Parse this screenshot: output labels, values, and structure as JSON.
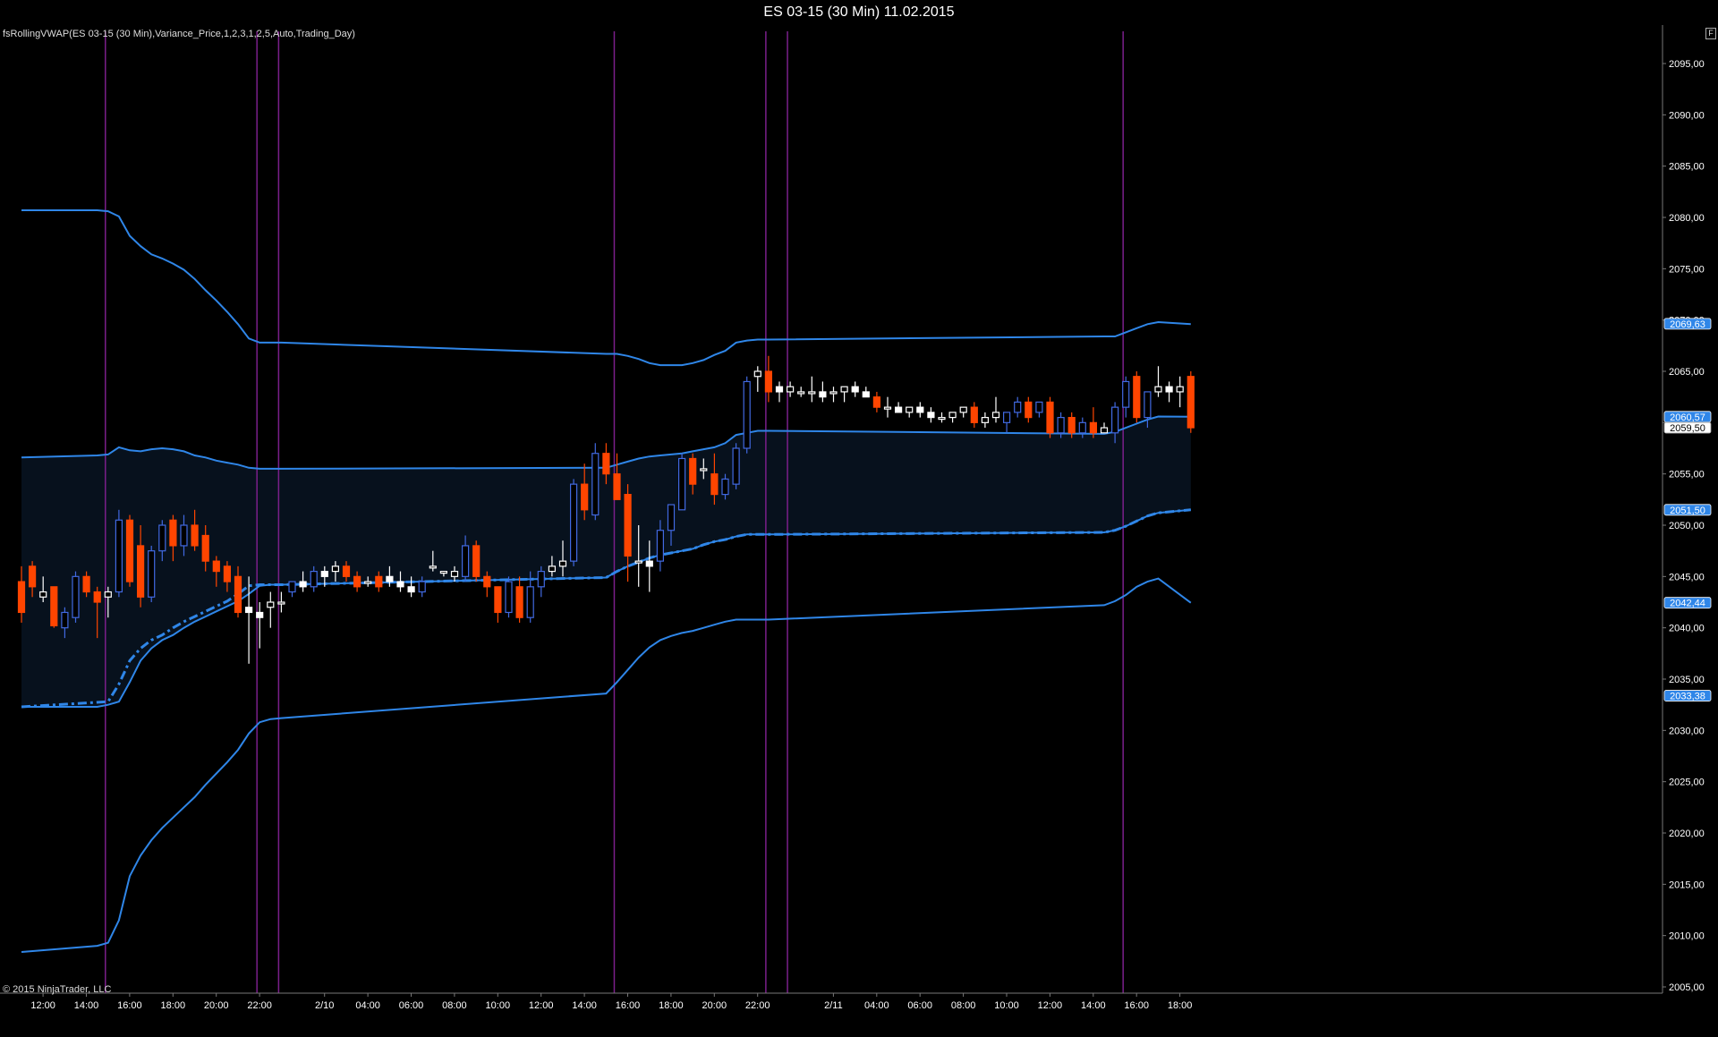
{
  "window": {
    "title": "ES 03-15 (30 Min)  11.02.2015",
    "indicator_label": "fsRollingVWAP(ES 03-15 (30 Min),Variance_Price,1,2,3,1,2,5,Auto,Trading_Day)",
    "copyright": "© 2015 NinjaTrader, LLC",
    "corner_button": "F"
  },
  "colors": {
    "background": "#000000",
    "band": "#2f86e8",
    "vwap": "#2f86e8",
    "band_fill": "#07111d",
    "candle_up": "#4169e1",
    "candle_down": "#ff4500",
    "doji": "#ffffff",
    "session_line": "#7a1f8a",
    "axis_text": "#ffffff",
    "price_marker": "#2f86e8"
  },
  "chart_data": {
    "type": "candlestick",
    "bar_interval_min": 30,
    "x_start": "2015-02-09 11:30",
    "ylim": [
      2004,
      2099
    ],
    "y_ticks": [
      "2005,00",
      "2010,00",
      "2015,00",
      "2020,00",
      "2025,00",
      "2030,00",
      "2035,00",
      "2040,00",
      "2045,00",
      "2050,00",
      "2055,00",
      "2060,00",
      "2065,00",
      "2070,00",
      "2075,00",
      "2080,00",
      "2085,00",
      "2090,00",
      "2095,00"
    ],
    "y_tick_values": [
      2005,
      2010,
      2015,
      2020,
      2025,
      2030,
      2035,
      2040,
      2045,
      2050,
      2055,
      2060,
      2065,
      2070,
      2075,
      2080,
      2085,
      2090,
      2095
    ],
    "x_ticks": [
      {
        "label": "12:00",
        "bar": 1
      },
      {
        "label": "14:00",
        "bar": 5
      },
      {
        "label": "16:00",
        "bar": 9
      },
      {
        "label": "18:00",
        "bar": 13
      },
      {
        "label": "20:00",
        "bar": 17
      },
      {
        "label": "22:00",
        "bar": 21
      },
      {
        "label": "2/10",
        "bar": 27
      },
      {
        "label": "04:00",
        "bar": 31
      },
      {
        "label": "06:00",
        "bar": 35
      },
      {
        "label": "08:00",
        "bar": 39
      },
      {
        "label": "10:00",
        "bar": 43
      },
      {
        "label": "12:00",
        "bar": 47
      },
      {
        "label": "14:00",
        "bar": 51
      },
      {
        "label": "16:00",
        "bar": 55
      },
      {
        "label": "18:00",
        "bar": 59
      },
      {
        "label": "20:00",
        "bar": 63
      },
      {
        "label": "22:00",
        "bar": 67
      },
      {
        "label": "2/11",
        "bar": 74
      },
      {
        "label": "04:00",
        "bar": 78
      },
      {
        "label": "06:00",
        "bar": 82
      },
      {
        "label": "08:00",
        "bar": 86
      },
      {
        "label": "10:00",
        "bar": 90
      },
      {
        "label": "12:00",
        "bar": 94
      },
      {
        "label": "14:00",
        "bar": 98
      },
      {
        "label": "16:00",
        "bar": 102
      },
      {
        "label": "18:00",
        "bar": 106
      }
    ],
    "session_lines": [
      7.75,
      21.75,
      23.75,
      54.75,
      68.75,
      70.75,
      101.75
    ],
    "price_markers": [
      {
        "label": "2069,63",
        "value": 2069.63,
        "style": "band"
      },
      {
        "label": "2060,57",
        "value": 2060.57,
        "style": "band"
      },
      {
        "label": "2059,50",
        "value": 2059.5,
        "style": "last"
      },
      {
        "label": "2051,50",
        "value": 2051.5,
        "style": "band"
      },
      {
        "label": "2042,44",
        "value": 2042.44,
        "style": "band"
      },
      {
        "label": "2033,38",
        "value": 2033.38,
        "style": "band"
      }
    ],
    "vwap": {
      "bars": [
        0,
        8,
        9,
        10,
        11,
        12,
        13,
        14,
        15,
        16,
        17,
        18,
        19,
        20,
        21,
        22,
        23,
        24,
        54,
        55,
        56,
        57,
        58,
        59,
        60,
        61,
        62,
        63,
        64,
        65,
        66,
        67,
        68,
        69,
        100,
        101,
        102,
        103,
        104,
        105,
        108
      ],
      "values": [
        2032.3,
        2032.8,
        2034.5,
        2036.8,
        2038.0,
        2038.8,
        2039.3,
        2040.0,
        2040.6,
        2041.1,
        2041.6,
        2042.1,
        2042.6,
        2043.3,
        2044.1,
        2044.2,
        2044.2,
        2044.2,
        2044.9,
        2045.5,
        2046.0,
        2046.4,
        2046.8,
        2047.1,
        2047.3,
        2047.5,
        2047.7,
        2048.1,
        2048.4,
        2048.6,
        2048.9,
        2049.1,
        2049.1,
        2049.1,
        2049.3,
        2049.5,
        2049.9,
        2050.4,
        2050.9,
        2051.2,
        2051.5
      ]
    },
    "bands": {
      "bars": [
        0,
        7,
        8,
        9,
        10,
        11,
        12,
        13,
        14,
        15,
        16,
        17,
        18,
        19,
        20,
        21,
        22,
        23,
        24,
        54,
        55,
        56,
        57,
        58,
        59,
        60,
        61,
        62,
        63,
        64,
        65,
        66,
        67,
        68,
        69,
        100,
        101,
        102,
        103,
        104,
        105,
        108
      ],
      "upper3": [
        2080.7,
        2080.7,
        2080.6,
        2080.1,
        2078.2,
        2077.2,
        2076.4,
        2076.0,
        2075.5,
        2074.9,
        2074.0,
        2072.9,
        2071.9,
        2070.8,
        2069.6,
        2068.2,
        2067.8,
        2067.8,
        2067.8,
        2066.7,
        2066.7,
        2066.5,
        2066.2,
        2065.8,
        2065.6,
        2065.6,
        2065.6,
        2065.8,
        2066.1,
        2066.6,
        2067.0,
        2067.8,
        2068.0,
        2068.1,
        2068.1,
        2068.4,
        2068.4,
        2068.8,
        2069.2,
        2069.6,
        2069.8,
        2069.6
      ],
      "upper2": [
        2056.6,
        2056.8,
        2056.9,
        2057.6,
        2057.3,
        2057.2,
        2057.4,
        2057.5,
        2057.4,
        2057.2,
        2056.8,
        2056.6,
        2056.3,
        2056.1,
        2055.9,
        2055.6,
        2055.5,
        2055.5,
        2055.5,
        2055.6,
        2055.9,
        2056.2,
        2056.5,
        2056.7,
        2056.8,
        2056.9,
        2057.0,
        2057.2,
        2057.4,
        2057.6,
        2058.0,
        2058.8,
        2059.0,
        2059.2,
        2059.2,
        2058.9,
        2059.1,
        2059.5,
        2059.9,
        2060.3,
        2060.6,
        2060.57
      ],
      "lower2": [
        2008.4,
        2009.0,
        2009.3,
        2011.5,
        2015.8,
        2017.8,
        2019.3,
        2020.5,
        2021.5,
        2022.5,
        2023.5,
        2024.7,
        2025.8,
        2026.9,
        2028.1,
        2029.7,
        2030.8,
        2031.1,
        2031.2,
        2033.6,
        2034.7,
        2035.9,
        2037.1,
        2038.1,
        2038.8,
        2039.2,
        2039.5,
        2039.7,
        2040.0,
        2040.3,
        2040.6,
        2040.8,
        2040.8,
        2040.8,
        2040.8,
        2042.2,
        2042.6,
        2043.2,
        2044.0,
        2044.5,
        2044.8,
        2042.44
      ],
      "lower1": [
        2032.3,
        2032.3,
        2032.5,
        2032.8,
        2034.7,
        2036.8,
        2038.0,
        2038.8,
        2039.3,
        2040.0,
        2040.6,
        2041.1,
        2041.6,
        2042.1,
        2042.6,
        2043.3,
        2044.1,
        2044.2,
        2044.2,
        2044.9,
        2045.5,
        2046.0,
        2046.4,
        2046.8,
        2047.1,
        2047.3,
        2047.5,
        2047.7,
        2048.1,
        2048.4,
        2048.6,
        2048.9,
        2049.1,
        2049.1,
        2049.1,
        2049.3,
        2049.5,
        2049.9,
        2050.4,
        2050.9,
        2051.2,
        2051.5
      ]
    },
    "band_lines": {
      "upper_mid_bars": [
        0,
        7,
        8,
        9,
        10,
        11,
        12,
        13,
        14,
        15,
        16,
        17,
        18,
        19,
        20,
        21,
        22,
        23,
        24,
        54,
        55,
        56,
        57,
        58,
        59,
        60,
        61,
        62,
        63,
        64,
        65,
        66,
        67,
        68,
        69,
        100,
        101,
        102,
        103,
        104,
        105,
        108
      ],
      "upper_mid": [
        2056.6,
        2056.7,
        2056.7,
        2057.4,
        2057.1,
        2057.0,
        2057.2,
        2057.3,
        2057.2,
        2057.0,
        2056.6,
        2056.4,
        2056.1,
        2055.9,
        2055.7,
        2055.5,
        2055.5,
        2055.5,
        2055.5,
        2055.6,
        2055.9,
        2056.2,
        2056.5,
        2056.7,
        2056.8,
        2056.9,
        2057.0,
        2057.2,
        2057.4,
        2057.6,
        2058.0,
        2058.8,
        2059.0,
        2059.2,
        2059.2,
        2058.9,
        2059.1,
        2059.5,
        2059.9,
        2060.3,
        2060.6,
        2060.57
      ],
      "lower_mid": [
        2032.4,
        2032.5,
        2032.7,
        2033.2,
        2035.6,
        2037.8,
        2039.2,
        2040.2,
        2041.0,
        2041.8,
        2042.6,
        2043.4,
        2044.2,
        2045.0,
        2045.8,
        2046.6,
        2047.5,
        2047.7,
        2047.8,
        2049.6,
        2050.0,
        2050.6,
        2051.1,
        2051.6,
        2052.0,
        2052.3,
        2052.6,
        2052.9,
        2053.2,
        2053.6,
        2054.0,
        2054.3,
        2054.4,
        2054.4,
        2054.4,
        2054.8,
        2055.0,
        2055.5,
        2056.0,
        2056.5,
        2056.9,
        2042.44
      ]
    },
    "candles": [
      [
        2044.5,
        2046.0,
        2040.5,
        2041.5
      ],
      [
        2046.0,
        2046.5,
        2043.0,
        2044.0
      ],
      [
        2043.0,
        2045.0,
        2042.5,
        2043.5
      ],
      [
        2044.0,
        2044.0,
        2040.0,
        2040.2
      ],
      [
        2040.0,
        2042.0,
        2039.0,
        2041.5
      ],
      [
        2041.0,
        2045.5,
        2040.5,
        2045.0
      ],
      [
        2045.0,
        2045.5,
        2043.0,
        2043.5
      ],
      [
        2043.5,
        2044.0,
        2039.0,
        2042.5
      ],
      [
        2043.0,
        2044.0,
        2041.0,
        2043.5
      ],
      [
        2043.5,
        2051.5,
        2043.0,
        2050.5
      ],
      [
        2050.5,
        2051.0,
        2044.0,
        2044.5
      ],
      [
        2048.0,
        2050.0,
        2042.0,
        2043.0
      ],
      [
        2043.0,
        2048.0,
        2042.5,
        2047.5
      ],
      [
        2047.5,
        2050.5,
        2046.5,
        2050.0
      ],
      [
        2050.5,
        2051.0,
        2046.5,
        2048.0
      ],
      [
        2048.0,
        2051.0,
        2047.0,
        2050.0
      ],
      [
        2050.0,
        2051.5,
        2047.5,
        2048.0
      ],
      [
        2049.0,
        2050.0,
        2045.5,
        2046.5
      ],
      [
        2046.5,
        2047.0,
        2044.0,
        2045.5
      ],
      [
        2046.0,
        2046.5,
        2043.5,
        2044.5
      ],
      [
        2045.0,
        2046.0,
        2041.0,
        2041.5
      ],
      [
        2042.0,
        2045.0,
        2036.5,
        2041.5
      ],
      [
        2041.5,
        2042.5,
        2038.0,
        2041.0
      ],
      [
        2042.0,
        2043.5,
        2040.0,
        2042.5
      ],
      [
        2042.5,
        2043.5,
        2041.5,
        2042.5
      ],
      [
        2043.5,
        2044.5,
        2043.0,
        2044.5
      ],
      [
        2044.5,
        2045.5,
        2043.5,
        2044.0
      ],
      [
        2044.0,
        2046.0,
        2043.5,
        2045.5
      ],
      [
        2045.5,
        2046.0,
        2044.0,
        2045.0
      ],
      [
        2045.5,
        2046.5,
        2044.5,
        2046.0
      ],
      [
        2046.0,
        2046.5,
        2044.5,
        2045.0
      ],
      [
        2045.0,
        2045.5,
        2043.5,
        2044.0
      ],
      [
        2044.5,
        2045.0,
        2044.0,
        2044.5
      ],
      [
        2045.0,
        2045.5,
        2043.5,
        2044.0
      ],
      [
        2045.0,
        2046.0,
        2044.0,
        2044.5
      ],
      [
        2044.5,
        2045.5,
        2043.5,
        2044.0
      ],
      [
        2044.0,
        2045.0,
        2043.0,
        2043.5
      ],
      [
        2043.5,
        2045.0,
        2043.0,
        2044.5
      ],
      [
        2046.0,
        2047.5,
        2045.5,
        2046.0
      ],
      [
        2045.5,
        2045.5,
        2045.0,
        2045.5
      ],
      [
        2045.0,
        2046.0,
        2044.5,
        2045.5
      ],
      [
        2045.0,
        2049.0,
        2044.5,
        2048.0
      ],
      [
        2048.0,
        2048.5,
        2044.5,
        2045.0
      ],
      [
        2045.0,
        2045.5,
        2043.0,
        2044.0
      ],
      [
        2044.0,
        2044.0,
        2040.5,
        2041.5
      ],
      [
        2041.5,
        2045.0,
        2041.0,
        2044.5
      ],
      [
        2044.0,
        2045.0,
        2040.5,
        2041.0
      ],
      [
        2041.0,
        2045.5,
        2040.5,
        2044.0
      ],
      [
        2044.0,
        2046.0,
        2043.0,
        2045.5
      ],
      [
        2045.5,
        2047.0,
        2045.0,
        2046.0
      ],
      [
        2046.0,
        2048.5,
        2045.0,
        2046.5
      ],
      [
        2046.5,
        2054.5,
        2046.0,
        2054.0
      ],
      [
        2054.0,
        2056.0,
        2050.5,
        2051.5
      ],
      [
        2051.0,
        2058.0,
        2050.5,
        2057.0
      ],
      [
        2057.0,
        2058.0,
        2054.0,
        2055.0
      ],
      [
        2055.0,
        2057.0,
        2052.5,
        2052.5
      ],
      [
        2053.0,
        2054.0,
        2044.5,
        2047.0
      ],
      [
        2046.5,
        2050.0,
        2044.0,
        2046.5
      ],
      [
        2046.5,
        2048.5,
        2043.5,
        2046.0
      ],
      [
        2046.5,
        2050.5,
        2045.5,
        2049.5
      ],
      [
        2049.5,
        2052.0,
        2048.0,
        2052.0
      ],
      [
        2051.5,
        2057.0,
        2051.5,
        2056.5
      ],
      [
        2056.5,
        2057.0,
        2053.0,
        2054.0
      ],
      [
        2055.5,
        2056.5,
        2054.5,
        2055.5
      ],
      [
        2055.0,
        2057.0,
        2052.0,
        2053.0
      ],
      [
        2053.0,
        2055.0,
        2052.5,
        2054.5
      ],
      [
        2054.0,
        2058.0,
        2053.5,
        2057.5
      ],
      [
        2057.5,
        2064.5,
        2057.0,
        2064.0
      ],
      [
        2064.5,
        2065.5,
        2063.0,
        2065.0
      ],
      [
        2065.0,
        2066.5,
        2062.0,
        2063.0
      ],
      [
        2063.5,
        2064.0,
        2062.0,
        2063.0
      ],
      [
        2063.0,
        2064.0,
        2062.5,
        2063.5
      ],
      [
        2063.0,
        2063.5,
        2062.5,
        2063.0
      ],
      [
        2063.0,
        2064.5,
        2062.0,
        2063.0
      ],
      [
        2063.0,
        2064.0,
        2062.0,
        2062.5
      ],
      [
        2063.0,
        2063.5,
        2062.0,
        2063.0
      ],
      [
        2063.0,
        2063.5,
        2062.0,
        2063.5
      ],
      [
        2063.5,
        2064.0,
        2062.5,
        2063.0
      ],
      [
        2063.0,
        2063.5,
        2062.5,
        2062.5
      ],
      [
        2062.5,
        2063.0,
        2061.0,
        2061.5
      ],
      [
        2061.5,
        2062.5,
        2060.5,
        2061.5
      ],
      [
        2061.5,
        2062.0,
        2061.0,
        2061.0
      ],
      [
        2061.0,
        2061.5,
        2060.5,
        2061.5
      ],
      [
        2061.5,
        2062.0,
        2060.5,
        2061.0
      ],
      [
        2061.0,
        2061.5,
        2060.0,
        2060.5
      ],
      [
        2060.5,
        2061.0,
        2060.0,
        2060.5
      ],
      [
        2060.5,
        2061.0,
        2060.0,
        2061.0
      ],
      [
        2061.0,
        2061.5,
        2060.5,
        2061.5
      ],
      [
        2061.5,
        2062.0,
        2059.5,
        2060.0
      ],
      [
        2060.0,
        2061.0,
        2059.5,
        2060.5
      ],
      [
        2060.5,
        2062.5,
        2060.0,
        2061.0
      ],
      [
        2060.0,
        2061.0,
        2059.0,
        2061.0
      ],
      [
        2061.0,
        2062.5,
        2060.5,
        2062.0
      ],
      [
        2062.0,
        2062.5,
        2060.0,
        2060.5
      ],
      [
        2061.0,
        2062.0,
        2060.5,
        2062.0
      ],
      [
        2062.0,
        2062.5,
        2058.5,
        2059.0
      ],
      [
        2059.0,
        2061.0,
        2058.5,
        2060.5
      ],
      [
        2060.5,
        2061.0,
        2058.5,
        2059.0
      ],
      [
        2059.0,
        2060.5,
        2058.5,
        2060.0
      ],
      [
        2060.0,
        2061.5,
        2058.5,
        2059.0
      ],
      [
        2059.0,
        2060.0,
        2059.0,
        2059.5
      ],
      [
        2059.0,
        2062.0,
        2058.0,
        2061.5
      ],
      [
        2061.5,
        2064.5,
        2060.5,
        2064.0
      ],
      [
        2064.5,
        2065.0,
        2060.0,
        2060.5
      ],
      [
        2060.5,
        2063.0,
        2059.5,
        2063.0
      ],
      [
        2063.0,
        2065.5,
        2062.5,
        2063.5
      ],
      [
        2063.5,
        2064.0,
        2062.0,
        2063.0
      ],
      [
        2063.0,
        2064.5,
        2061.5,
        2063.5
      ],
      [
        2064.5,
        2065.0,
        2059.0,
        2059.5
      ]
    ]
  }
}
